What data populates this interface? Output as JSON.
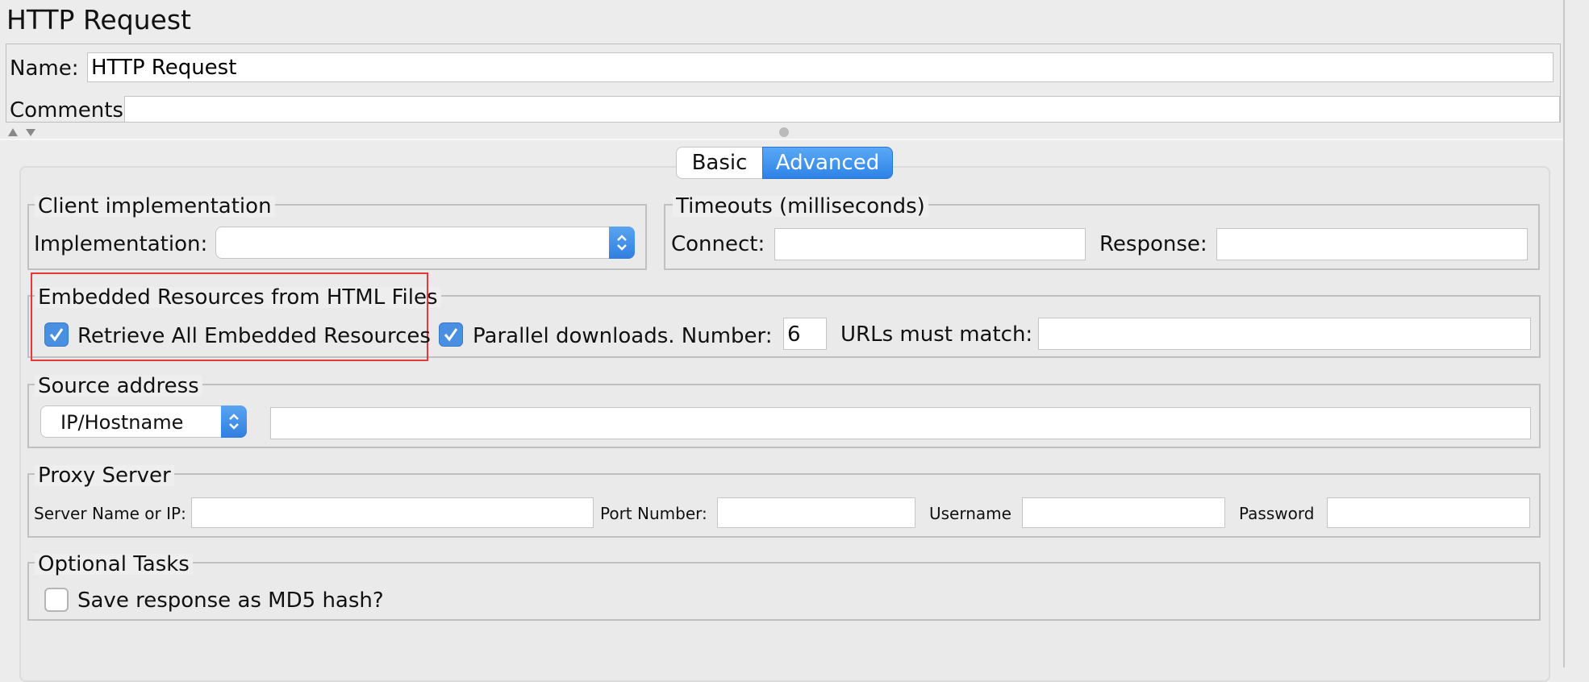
{
  "title": "HTTP Request",
  "name_row": {
    "label": "Name:",
    "value": "HTTP Request"
  },
  "comments_row": {
    "label": "Comments:",
    "value": ""
  },
  "tabs": [
    {
      "label": "Basic",
      "selected": false
    },
    {
      "label": "Advanced",
      "selected": true
    }
  ],
  "client_impl": {
    "legend": "Client implementation",
    "label": "Implementation:",
    "value": ""
  },
  "timeouts": {
    "legend": "Timeouts (milliseconds)",
    "connect_label": "Connect:",
    "connect_value": "",
    "response_label": "Response:",
    "response_value": ""
  },
  "embedded": {
    "legend": "Embedded Resources from HTML Files",
    "retrieve_label": "Retrieve All Embedded Resources",
    "retrieve_checked": true,
    "parallel_label": "Parallel downloads. Number:",
    "parallel_checked": true,
    "parallel_number": "6",
    "urls_label": "URLs must match:",
    "urls_value": ""
  },
  "source_address": {
    "legend": "Source address",
    "type_value": "IP/Hostname",
    "value": ""
  },
  "proxy": {
    "legend": "Proxy Server",
    "server_label": "Server Name or IP:",
    "port_label": "Port Number:",
    "username_label": "Username",
    "password_label": "Password"
  },
  "optional": {
    "legend": "Optional Tasks",
    "md5_label": "Save response as MD5 hash?",
    "md5_checked": false
  },
  "colors": {
    "accent": "#4a90e2",
    "highlight_box": "#e53935",
    "background": "#ececec"
  }
}
